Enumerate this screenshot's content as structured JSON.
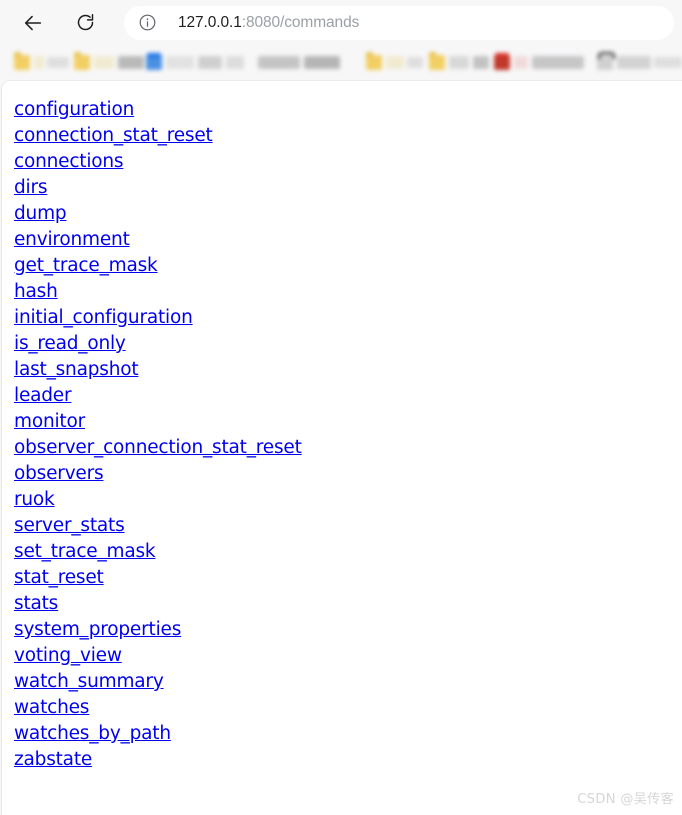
{
  "browser": {
    "back_button": "Back",
    "reload_button": "Reload",
    "site_info_button": "View site information",
    "url": {
      "host": "127.0.0.1",
      "path": ":8080/commands",
      "full": "127.0.0.1:8080/commands"
    }
  },
  "bookmarks_bar": {
    "redacted": true,
    "note": "Bookmark labels are blurred/unreadable in the screenshot",
    "items": [
      {
        "icon": "folder-icon",
        "label": "",
        "icon_color": "#f2cf63"
      },
      {
        "icon": "folder-icon",
        "label": "",
        "icon_color": "#f2cf63"
      },
      {
        "icon": "bookmark-icon",
        "label": "",
        "icon_color": "#4a90e2"
      },
      {
        "icon": "folder-icon",
        "label": "",
        "icon_color": "#f2cf63"
      },
      {
        "icon": "folder-icon",
        "label": "",
        "icon_color": "#f2cf63"
      },
      {
        "icon": "bookmark-icon",
        "label": "",
        "icon_color": "#c0392b"
      },
      {
        "icon": "bookmark-icon",
        "label": "",
        "icon_color": "#2b2b2b"
      }
    ]
  },
  "page": {
    "title": "commands",
    "link_color": "#0000ee",
    "links": [
      "configuration",
      "connection_stat_reset",
      "connections",
      "dirs",
      "dump",
      "environment",
      "get_trace_mask",
      "hash",
      "initial_configuration",
      "is_read_only",
      "last_snapshot",
      "leader",
      "monitor",
      "observer_connection_stat_reset",
      "observers",
      "ruok",
      "server_stats",
      "set_trace_mask",
      "stat_reset",
      "stats",
      "system_properties",
      "voting_view",
      "watch_summary",
      "watches",
      "watches_by_path",
      "zabstate"
    ]
  },
  "watermark": {
    "text": "CSDN @吴传客"
  }
}
